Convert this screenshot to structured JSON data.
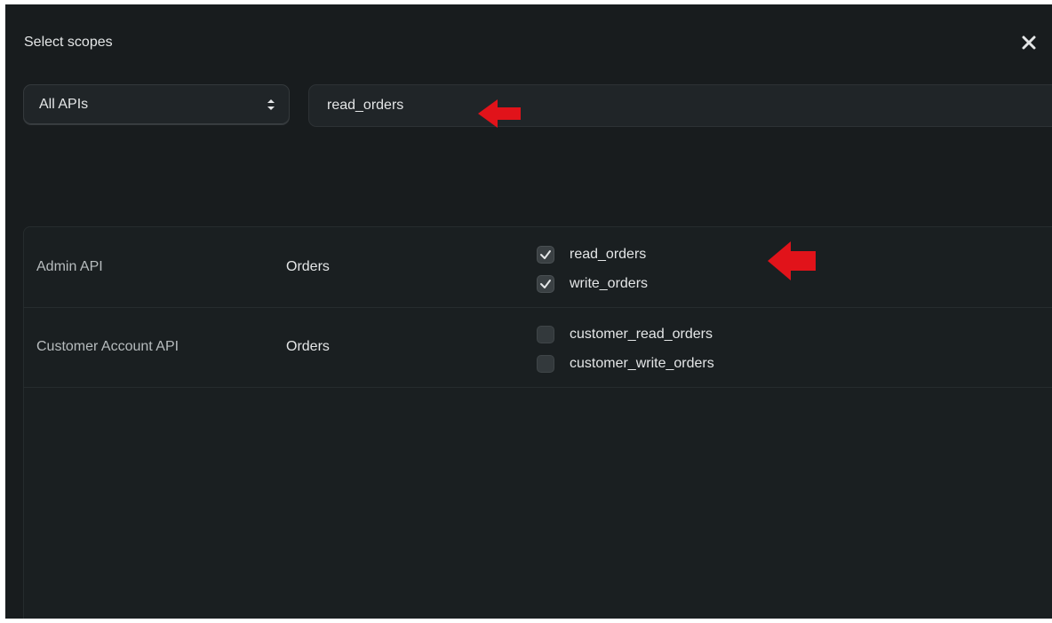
{
  "modal": {
    "title": "Select scopes"
  },
  "filters": {
    "api_select": "All APIs",
    "search_value": "read_orders"
  },
  "rows": [
    {
      "api": "Admin API",
      "resource": "Orders",
      "scopes": [
        {
          "label": "read_orders",
          "checked": true
        },
        {
          "label": "write_orders",
          "checked": true
        }
      ]
    },
    {
      "api": "Customer Account API",
      "resource": "Orders",
      "scopes": [
        {
          "label": "customer_read_orders",
          "checked": false
        },
        {
          "label": "customer_write_orders",
          "checked": false
        }
      ]
    }
  ],
  "icons": {
    "close": "close-icon",
    "select": "up-down-chevron-icon",
    "check": "check-icon",
    "annotation": "red-arrow-icon"
  },
  "colors": {
    "background": "#181c1e",
    "annotation": "#e1131a",
    "text": "#e4e6e7"
  }
}
